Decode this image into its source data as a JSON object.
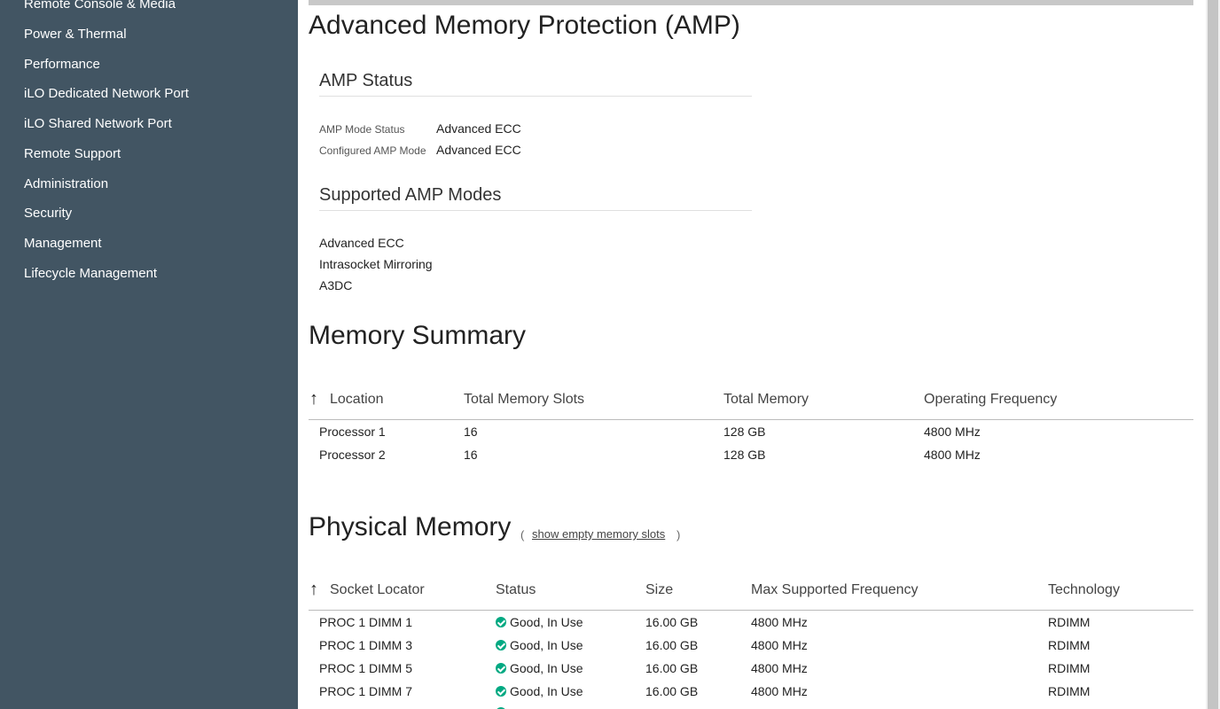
{
  "sidebar": {
    "items": [
      {
        "label": "Remote Console & Media"
      },
      {
        "label": "Power & Thermal"
      },
      {
        "label": "Performance"
      },
      {
        "label": "iLO Dedicated Network Port"
      },
      {
        "label": "iLO Shared Network Port"
      },
      {
        "label": "Remote Support"
      },
      {
        "label": "Administration"
      },
      {
        "label": "Security"
      },
      {
        "label": "Management"
      },
      {
        "label": "Lifecycle Management"
      }
    ]
  },
  "amp": {
    "title": "Advanced Memory Protection (AMP)",
    "status_heading": "AMP Status",
    "mode_status_label": "AMP Mode Status",
    "mode_status_value": "Advanced ECC",
    "configured_label": "Configured AMP Mode",
    "configured_value": "Advanced ECC",
    "supported_heading": "Supported AMP Modes",
    "supported_modes": [
      "Advanced ECC",
      "Intrasocket Mirroring",
      "A3DC"
    ]
  },
  "summary": {
    "title": "Memory Summary",
    "sort_icon": "arrow-up-icon",
    "columns": [
      "Location",
      "Total Memory Slots",
      "Total Memory",
      "Operating Frequency"
    ],
    "rows": [
      [
        "Processor 1",
        "16",
        "128 GB",
        "4800 MHz"
      ],
      [
        "Processor 2",
        "16",
        "128 GB",
        "4800 MHz"
      ]
    ]
  },
  "physical": {
    "title": "Physical Memory",
    "paren_open": "(",
    "show_empty_link": "show empty memory slots",
    "paren_close": ")",
    "sort_icon": "arrow-up-icon",
    "status_icon": "check-circle-icon",
    "status_color": "#01a982",
    "columns": [
      "Socket Locator",
      "Status",
      "Size",
      "Max Supported Frequency",
      "Technology"
    ],
    "rows": [
      [
        "PROC 1 DIMM 1",
        "Good, In Use",
        "16.00 GB",
        "4800 MHz",
        "RDIMM"
      ],
      [
        "PROC 1 DIMM 3",
        "Good, In Use",
        "16.00 GB",
        "4800 MHz",
        "RDIMM"
      ],
      [
        "PROC 1 DIMM 5",
        "Good, In Use",
        "16.00 GB",
        "4800 MHz",
        "RDIMM"
      ],
      [
        "PROC 1 DIMM 7",
        "Good, In Use",
        "16.00 GB",
        "4800 MHz",
        "RDIMM"
      ]
    ]
  },
  "colors": {
    "sidebar_bg": "#425563",
    "accent_green": "#01a982"
  }
}
